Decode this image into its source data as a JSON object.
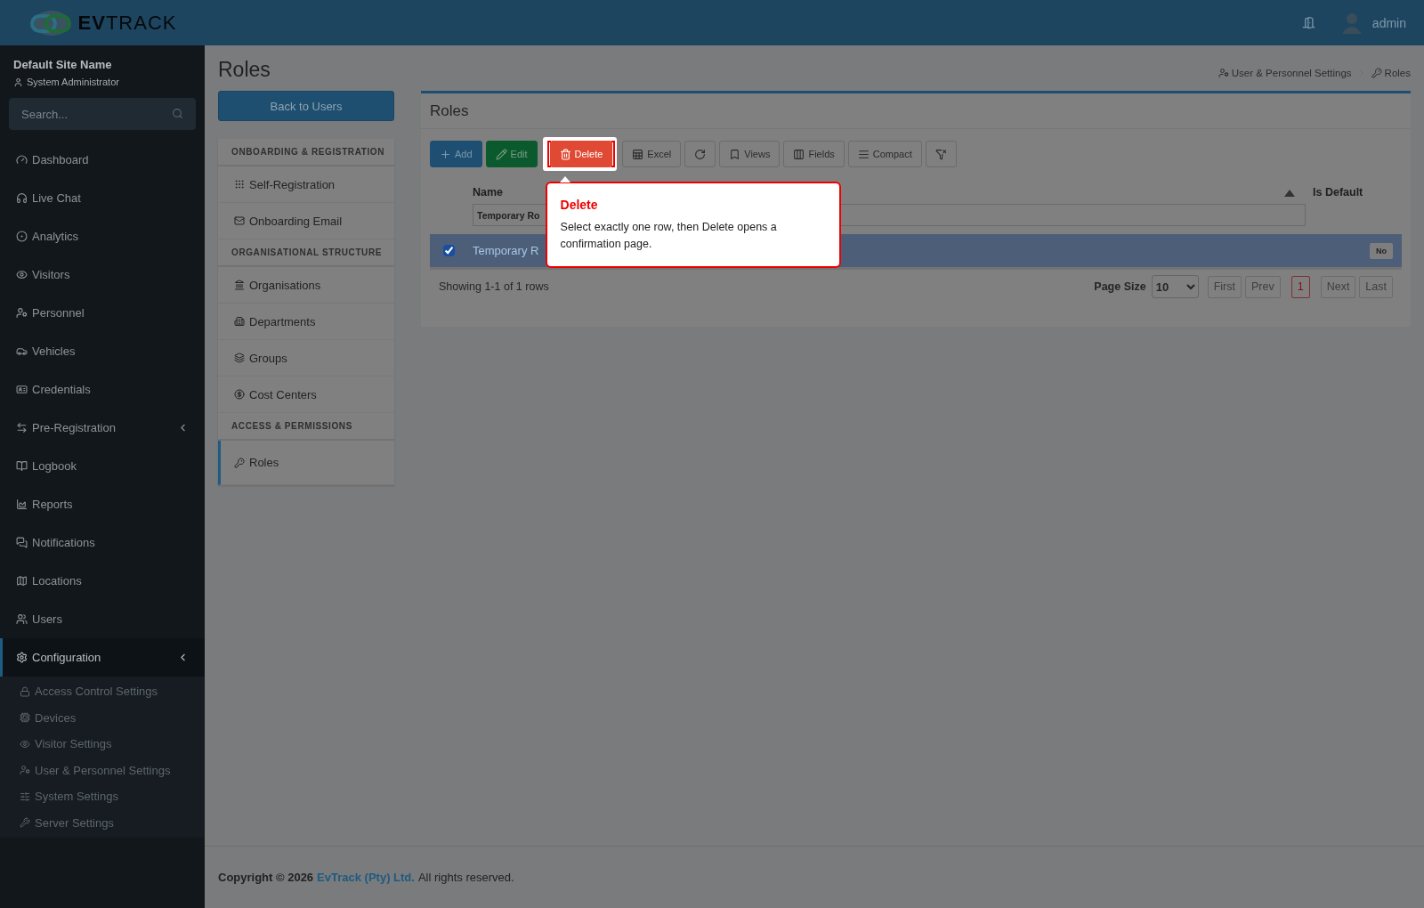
{
  "brand": {
    "logo_text_bold": "EV",
    "logo_text_light": "TRACK"
  },
  "top_bar": {
    "user": "admin"
  },
  "sidebar": {
    "site_name": "Default Site Name",
    "role": "System Administrator",
    "search": {
      "placeholder": "Search..."
    },
    "items": [
      {
        "label": "Dashboard",
        "selected": false,
        "has_caret": false
      },
      {
        "label": "Live Chat",
        "selected": false,
        "has_caret": false
      },
      {
        "label": "Analytics",
        "selected": false,
        "has_caret": false
      },
      {
        "label": "Visitors",
        "selected": false,
        "has_caret": false
      },
      {
        "label": "Personnel",
        "selected": false,
        "has_caret": false
      },
      {
        "label": "Vehicles",
        "selected": false,
        "has_caret": false
      },
      {
        "label": "Credentials",
        "selected": false,
        "has_caret": false
      },
      {
        "label": "Pre-Registration",
        "selected": false,
        "has_caret": true
      },
      {
        "label": "Logbook",
        "selected": false,
        "has_caret": false
      },
      {
        "label": "Reports",
        "selected": false,
        "has_caret": false
      },
      {
        "label": "Notifications",
        "selected": false,
        "has_caret": false
      },
      {
        "label": "Locations",
        "selected": false,
        "has_caret": false
      },
      {
        "label": "Users",
        "selected": false,
        "has_caret": false
      },
      {
        "label": "Configuration",
        "selected": true,
        "has_caret": true,
        "children": [
          {
            "label": "Access Control Settings"
          },
          {
            "label": "Devices"
          },
          {
            "label": "Visitor Settings"
          },
          {
            "label": "User & Personnel Settings"
          },
          {
            "label": "System Settings"
          },
          {
            "label": "Server Settings"
          }
        ]
      }
    ]
  },
  "page": {
    "title": "Roles",
    "breadcrumb": [
      "User & Personnel Settings",
      "Roles"
    ],
    "back_button": "Back to Users"
  },
  "sub_nav": [
    {
      "kind": "section",
      "label": "ONBOARDING & REGISTRATION"
    },
    {
      "kind": "link",
      "label": "Self-Registration",
      "selected": false
    },
    {
      "kind": "link",
      "label": "Onboarding Email",
      "selected": false
    },
    {
      "kind": "section",
      "label": "ORGANISATIONAL STRUCTURE"
    },
    {
      "kind": "link",
      "label": "Organisations",
      "selected": false
    },
    {
      "kind": "link",
      "label": "Departments",
      "selected": false
    },
    {
      "kind": "link",
      "label": "Groups",
      "selected": false
    },
    {
      "kind": "link",
      "label": "Cost Centers",
      "selected": false
    },
    {
      "kind": "section",
      "label": "ACCESS & PERMISSIONS"
    },
    {
      "kind": "link",
      "label": "Roles",
      "selected": true
    }
  ],
  "card": {
    "title": "Roles",
    "toolbar": [
      {
        "kind": "primary",
        "label": "Add"
      },
      {
        "kind": "success",
        "label": "Edit"
      },
      {
        "kind": "danger",
        "label": "Delete",
        "highlighted": true
      },
      {
        "kind": "plain",
        "label": "Excel"
      },
      {
        "kind": "plain"
      },
      {
        "kind": "plain",
        "label": "Views"
      },
      {
        "kind": "plain",
        "label": "Fields"
      },
      {
        "kind": "plain",
        "label": "Compact"
      },
      {
        "kind": "plain"
      }
    ],
    "table": {
      "columns": [
        "Name",
        "Is Default"
      ],
      "filter_value": "Temporary Ro",
      "rows": [
        {
          "selected": true,
          "checked": true,
          "name": "Temporary R",
          "is_default": "No"
        }
      ]
    },
    "summary": "Showing 1-1 of 1 rows",
    "page_size_label": "Page Size",
    "page_size": "10",
    "pager": [
      {
        "label": "First",
        "disabled": true,
        "selected": false
      },
      {
        "label": "Prev",
        "disabled": true,
        "selected": false
      },
      {
        "label": "1",
        "disabled": false,
        "selected": true
      },
      {
        "label": "Next",
        "disabled": true,
        "selected": false
      },
      {
        "label": "Last",
        "disabled": true,
        "selected": false
      }
    ]
  },
  "tooltip": {
    "title": "Delete",
    "text": "Select exactly one row, then Delete opens a confirmation page."
  },
  "footer": {
    "prefix": "Copyright © 2026",
    "company": "EvTrack (Pty) Ltd.",
    "suffix": "All rights reserved."
  }
}
